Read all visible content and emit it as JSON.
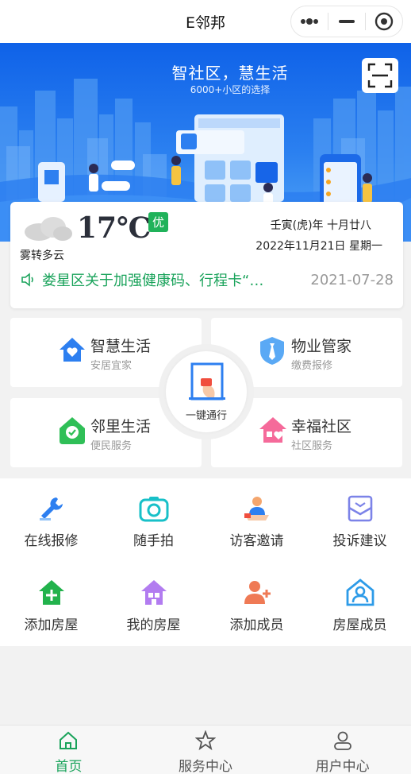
{
  "header": {
    "title": "E邻邦"
  },
  "banner": {
    "slogan": "智社区，慧生活",
    "subslogan": "6000+小区的选择"
  },
  "weather": {
    "temperature": "17℃",
    "aqi": "优",
    "description": "雾转多云",
    "lunar": "壬寅(虎)年 十月廿八",
    "date": "2022年11月21日 星期一"
  },
  "notice": {
    "text": "娄星区关于加强健康码、行程卡“…",
    "date": "2021-07-28"
  },
  "services": [
    {
      "title": "智慧生活",
      "subtitle": "安居宜家"
    },
    {
      "title": "物业管家",
      "subtitle": "缴费报修"
    },
    {
      "title": "邻里生活",
      "subtitle": "便民服务"
    },
    {
      "title": "幸福社区",
      "subtitle": "社区服务"
    }
  ],
  "center_button": {
    "label": "一键通行"
  },
  "quick": [
    {
      "label": "在线报修",
      "icon": "wrench-icon"
    },
    {
      "label": "随手拍",
      "icon": "camera-icon"
    },
    {
      "label": "访客邀请",
      "icon": "visitor-icon"
    },
    {
      "label": "投诉建议",
      "icon": "complaint-icon"
    },
    {
      "label": "添加房屋",
      "icon": "add-house-icon"
    },
    {
      "label": "我的房屋",
      "icon": "my-house-icon"
    },
    {
      "label": "添加成员",
      "icon": "add-member-icon"
    },
    {
      "label": "房屋成员",
      "icon": "house-member-icon"
    }
  ],
  "tabs": [
    {
      "label": "首页",
      "icon": "home-icon",
      "active": true
    },
    {
      "label": "服务中心",
      "icon": "star-icon",
      "active": false
    },
    {
      "label": "用户中心",
      "icon": "user-icon",
      "active": false
    }
  ],
  "colors": {
    "brand_green": "#1aa35b",
    "banner_blue": "#0f62e8"
  }
}
